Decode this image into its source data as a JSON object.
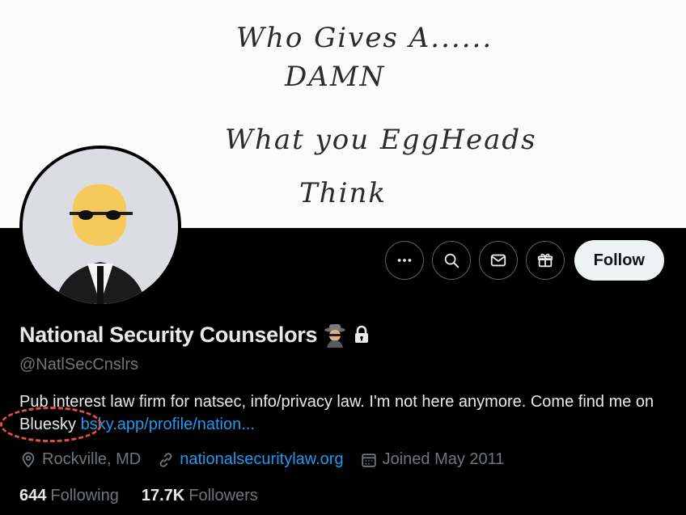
{
  "banner": {
    "lines": [
      "Who Gives A......",
      "DAMN",
      "What  you    EggHeads",
      "Think"
    ]
  },
  "profile": {
    "display_name": "National Security Counselors",
    "handle": "@NatlSecCnslrs",
    "bio_prefix": "Pub interest law firm for natsec, info/privacy law. I'm not here anymore. Come find me on ",
    "bio_bluesky": "Bluesky",
    "bio_link": "bsky.app/profile/nation...",
    "location": "Rockville, MD",
    "website": "nationalsecuritylaw.org",
    "joined": "Joined May 2011"
  },
  "actions": {
    "more_icon": "more-icon",
    "search_icon": "search-icon",
    "message_icon": "mail-icon",
    "gift_icon": "gift-icon",
    "follow_label": "Follow"
  },
  "stats": {
    "following_count": "644",
    "following_label": "Following",
    "followers_count": "17.7K",
    "followers_label": "Followers"
  },
  "colors": {
    "link": "#1d9bf0",
    "muted": "#71767b",
    "annotation": "#e0503c"
  }
}
